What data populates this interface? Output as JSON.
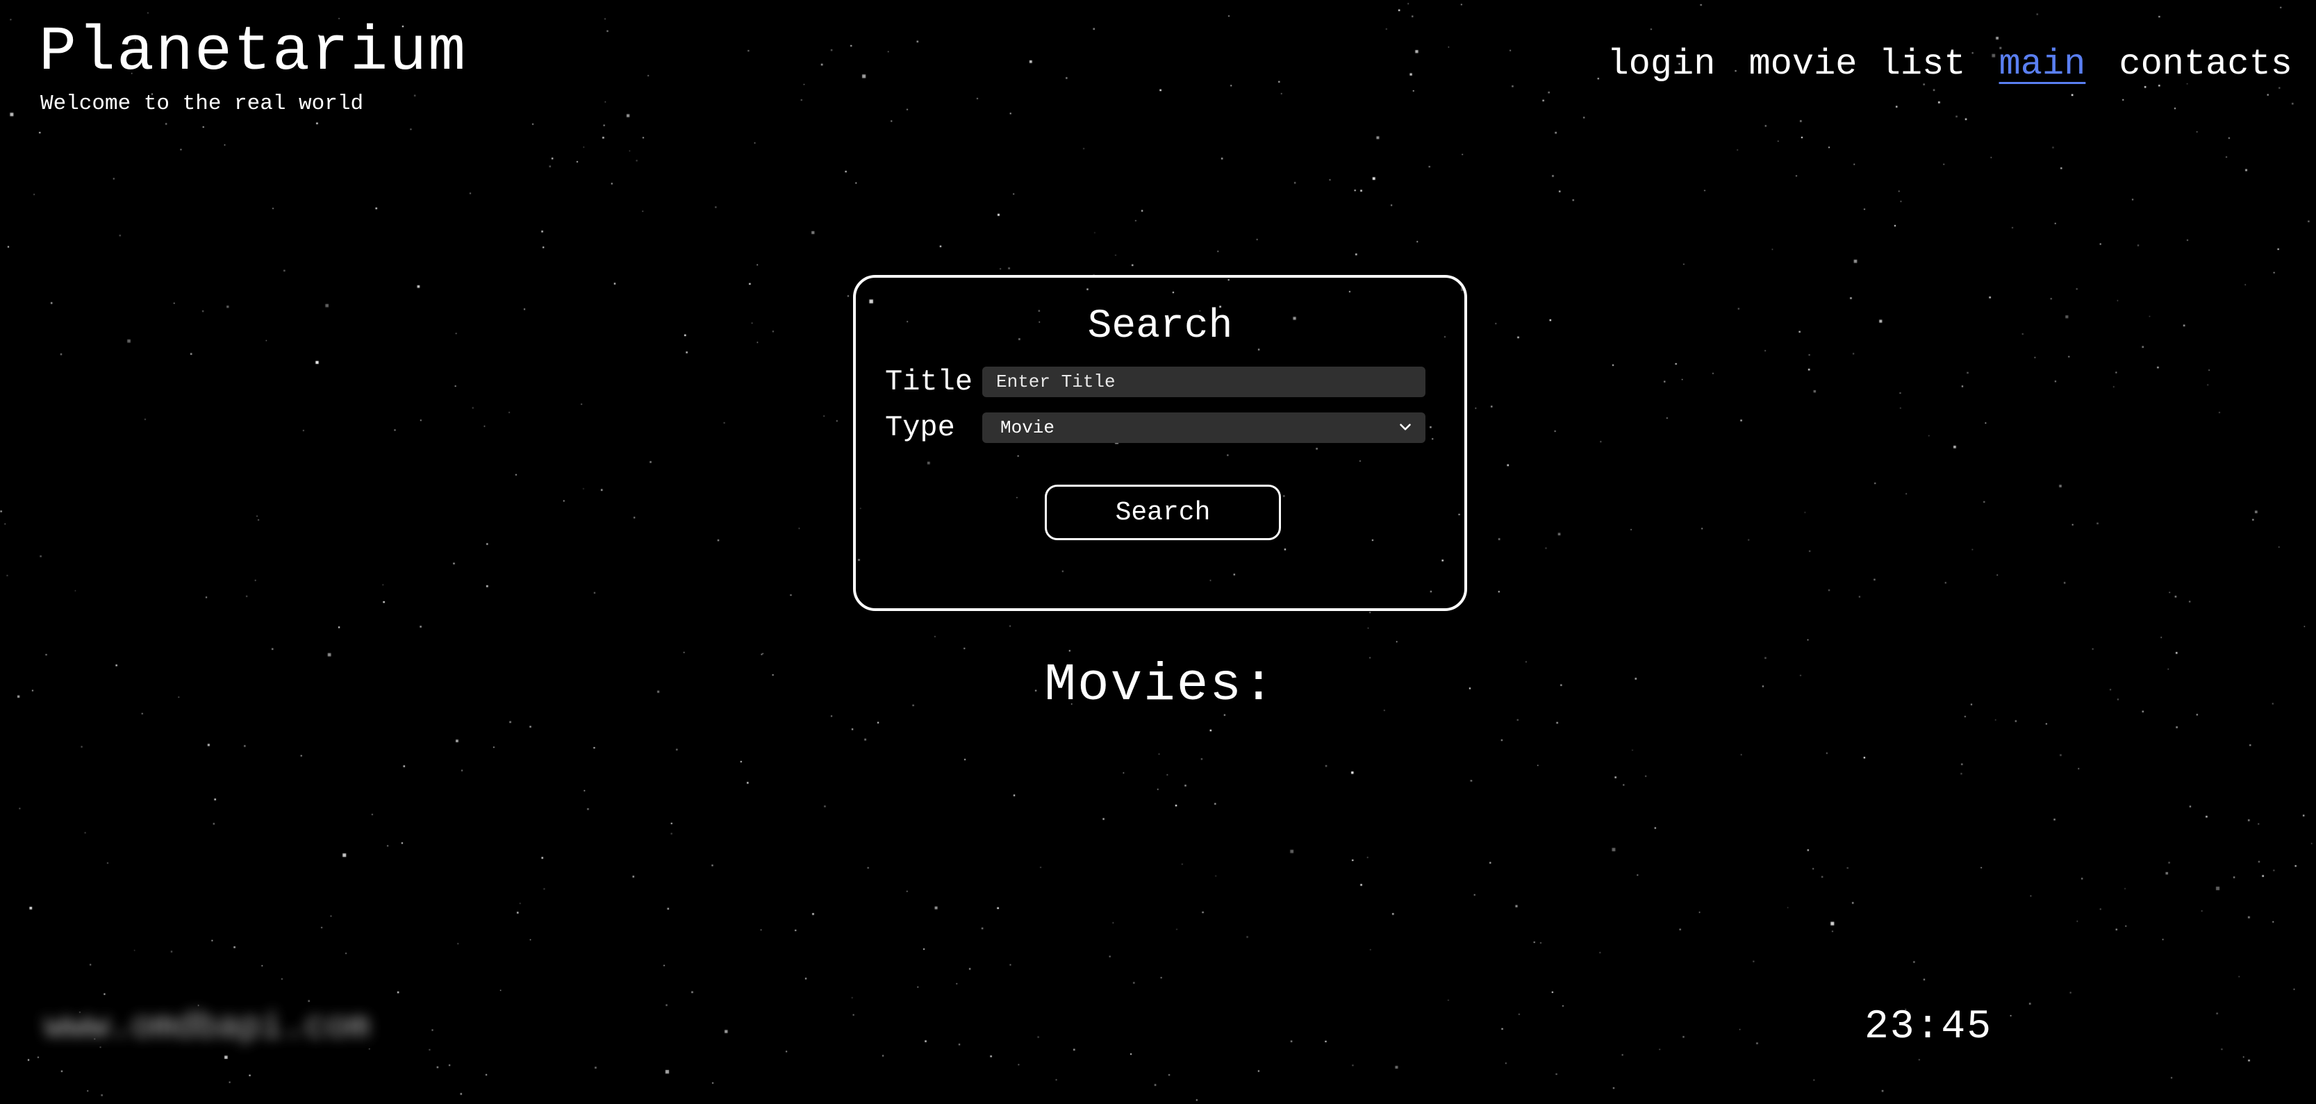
{
  "header": {
    "title": "Planetarium",
    "subtitle": "Welcome to the real world"
  },
  "nav": {
    "items": [
      {
        "label": "login"
      },
      {
        "label": "movie list"
      },
      {
        "label": "main",
        "active": true
      },
      {
        "label": "contacts"
      }
    ],
    "active_color": "#5a7ff2"
  },
  "search": {
    "heading": "Search",
    "title_label": "Title",
    "title_placeholder": "Enter Title",
    "title_value": "",
    "type_label": "Type",
    "type_selected": "Movie",
    "type_icon": "chevron-down-icon",
    "button_label": "Search"
  },
  "movies": {
    "heading": "Movies:",
    "items": []
  },
  "footer": {
    "site": "www.omdbapi.com",
    "site_blurred": true,
    "time": "23:45"
  },
  "theme": {
    "background": "#000000",
    "foreground": "#ffffff",
    "field_background": "#303030"
  }
}
